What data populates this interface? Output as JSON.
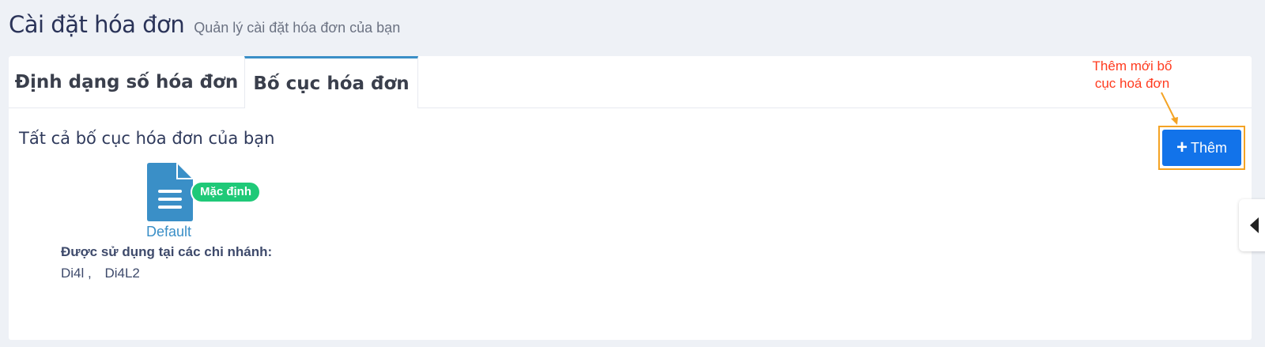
{
  "page": {
    "title": "Cài đặt hóa đơn",
    "subtitle": "Quản lý cài đặt hóa đơn của bạn"
  },
  "tabs": [
    {
      "label": "Định dạng số hóa đơn",
      "active": false
    },
    {
      "label": "Bố cục hóa đơn",
      "active": true
    }
  ],
  "section": {
    "title": "Tất cả bố cục hóa đơn của bạn"
  },
  "layout": {
    "name": "Default",
    "badge": "Mặc định",
    "icon": "document-icon",
    "branches_label": "Được sử dụng tại các chi nhánh:",
    "branches": [
      "Di4l ,",
      "Di4L2"
    ]
  },
  "annotation": {
    "text_line1": "Thêm mới bố",
    "text_line2": "cục hoá đơn"
  },
  "add_button": {
    "label": "Thêm",
    "icon": "plus-icon"
  },
  "colors": {
    "accent": "#1273ea",
    "tab_active": "#3a8fc7",
    "badge": "#1fc978",
    "annotation": "#ff3b1f",
    "highlight": "#f4a324"
  }
}
